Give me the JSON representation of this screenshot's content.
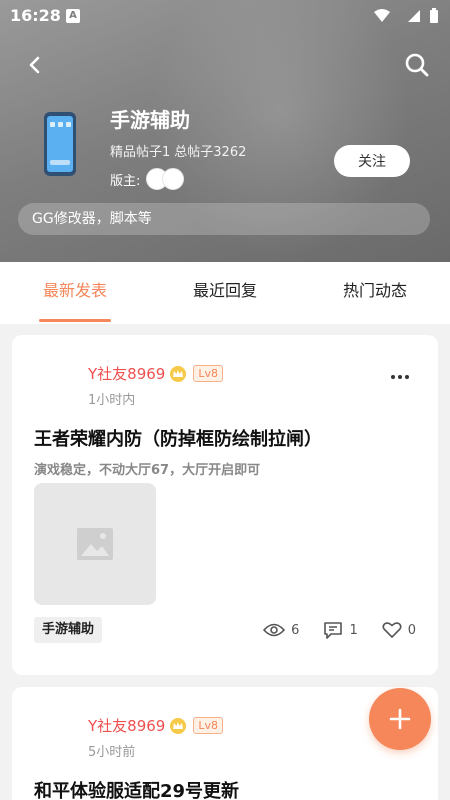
{
  "status_bar": {
    "time": "16:28",
    "notif_letter": "A"
  },
  "forum": {
    "title": "手游辅助",
    "stats_featured": "精品帖子1",
    "stats_total": "总帖子3262",
    "moderator_label": "版主:",
    "follow_label": "关注",
    "description": "GG修改器，脚本等"
  },
  "tabs": [
    {
      "label": "最新发表",
      "active": true
    },
    {
      "label": "最近回复",
      "active": false
    },
    {
      "label": "热门动态",
      "active": false
    }
  ],
  "posts": [
    {
      "username": "Y社友8969",
      "level": "Lv8",
      "time": "1小时内",
      "title": "王者荣耀内防（防掉框防绘制拉闸）",
      "excerpt": "演戏稳定，不动大厅67，大厅开启即可",
      "tag": "手游辅助",
      "views": "6",
      "comments": "1",
      "likes": "0"
    },
    {
      "username": "Y社友8969",
      "level": "Lv8",
      "time": "5小时前",
      "title": "和平体验服适配29号更新"
    }
  ],
  "colors": {
    "accent": "#f5875a",
    "username": "#f05050"
  },
  "icons": [
    "back-icon",
    "search-icon",
    "phone-app-icon",
    "more-icon",
    "image-placeholder-icon",
    "eye-icon",
    "comment-icon",
    "heart-icon",
    "plus-icon"
  ]
}
